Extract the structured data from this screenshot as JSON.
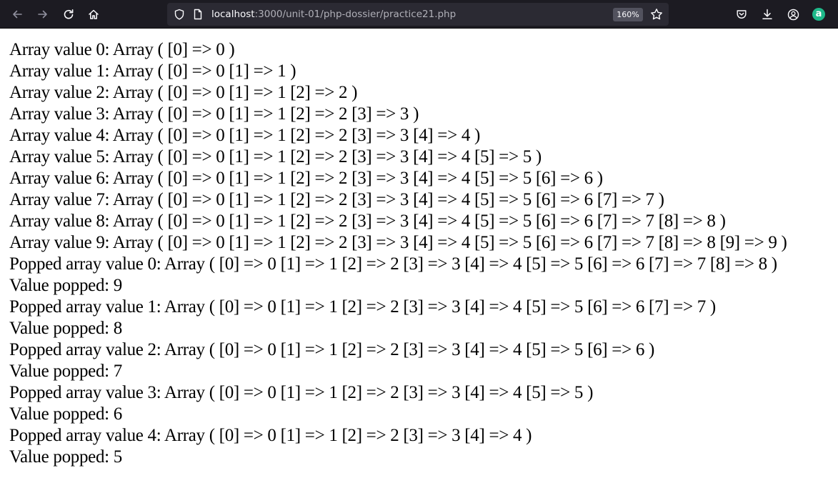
{
  "browser": {
    "url_host": "localhost",
    "url_rest": ":3000/unit-01/php-dossier/practice21.php",
    "zoom_level": "160%",
    "profile_letter": "a",
    "colors": {
      "toolbar_bg": "#1c1b22",
      "urlbar_bg": "#2b2a33",
      "extension_accent": "#1fb98a"
    },
    "icons": [
      "back-arrow-icon",
      "forward-arrow-icon",
      "reload-icon",
      "home-icon",
      "shield-icon",
      "page-info-icon",
      "bookmark-star-icon",
      "pocket-icon",
      "download-icon",
      "account-icon",
      "extension-icon"
    ]
  },
  "page": {
    "lines": [
      "Array value 0: Array ( [0] => 0 )",
      "Array value 1: Array ( [0] => 0 [1] => 1 )",
      "Array value 2: Array ( [0] => 0 [1] => 1 [2] => 2 )",
      "Array value 3: Array ( [0] => 0 [1] => 1 [2] => 2 [3] => 3 )",
      "Array value 4: Array ( [0] => 0 [1] => 1 [2] => 2 [3] => 3 [4] => 4 )",
      "Array value 5: Array ( [0] => 0 [1] => 1 [2] => 2 [3] => 3 [4] => 4 [5] => 5 )",
      "Array value 6: Array ( [0] => 0 [1] => 1 [2] => 2 [3] => 3 [4] => 4 [5] => 5 [6] => 6 )",
      "Array value 7: Array ( [0] => 0 [1] => 1 [2] => 2 [3] => 3 [4] => 4 [5] => 5 [6] => 6 [7] => 7 )",
      "Array value 8: Array ( [0] => 0 [1] => 1 [2] => 2 [3] => 3 [4] => 4 [5] => 5 [6] => 6 [7] => 7 [8] => 8 )",
      "Array value 9: Array ( [0] => 0 [1] => 1 [2] => 2 [3] => 3 [4] => 4 [5] => 5 [6] => 6 [7] => 7 [8] => 8 [9] => 9 )",
      "Popped array value 0: Array ( [0] => 0 [1] => 1 [2] => 2 [3] => 3 [4] => 4 [5] => 5 [6] => 6 [7] => 7 [8] => 8 )",
      "Value popped: 9",
      "Popped array value 1: Array ( [0] => 0 [1] => 1 [2] => 2 [3] => 3 [4] => 4 [5] => 5 [6] => 6 [7] => 7 )",
      "Value popped: 8",
      "Popped array value 2: Array ( [0] => 0 [1] => 1 [2] => 2 [3] => 3 [4] => 4 [5] => 5 [6] => 6 )",
      "Value popped: 7",
      "Popped array value 3: Array ( [0] => 0 [1] => 1 [2] => 2 [3] => 3 [4] => 4 [5] => 5 )",
      "Value popped: 6",
      "Popped array value 4: Array ( [0] => 0 [1] => 1 [2] => 2 [3] => 3 [4] => 4 )",
      "Value popped: 5"
    ]
  }
}
